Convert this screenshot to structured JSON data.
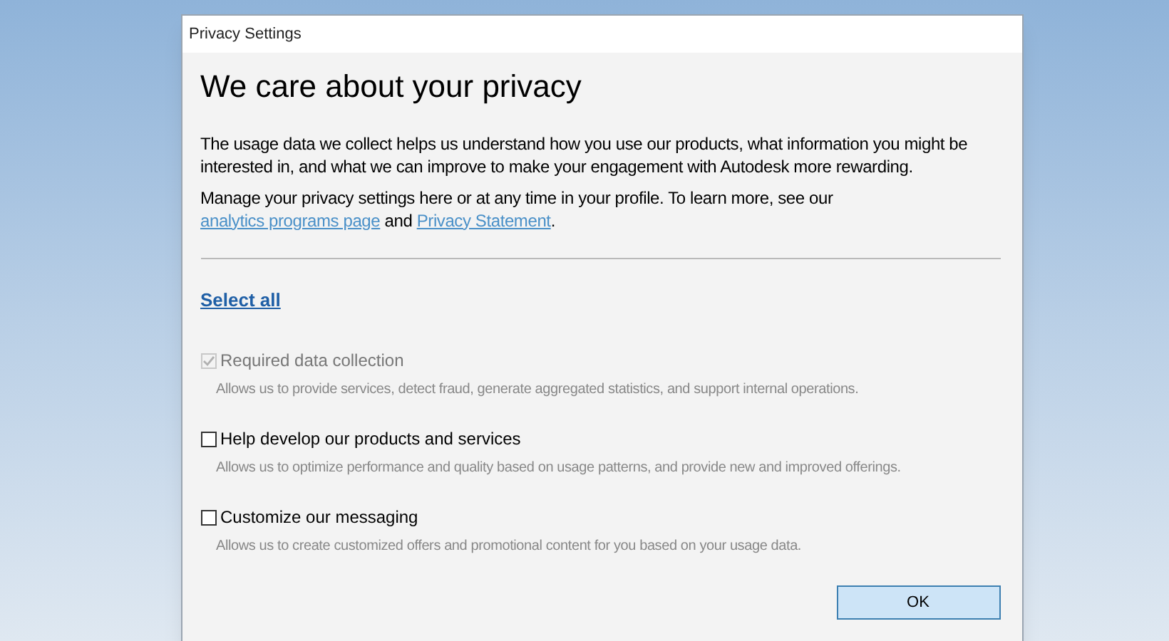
{
  "window": {
    "title": "Privacy Settings"
  },
  "heading": "We care about your privacy",
  "intro": "The usage data we collect helps us understand how you use our products, what information you might be interested in, and what we can improve to make your engagement with Autodesk more rewarding.",
  "manage": {
    "text_before": "Manage your privacy settings here or at any time in your profile. To learn more, see our",
    "link_1": "analytics programs page",
    "text_between": "and",
    "link_2": "Privacy Statement",
    "text_after": "."
  },
  "select_all": "Select all",
  "options": [
    {
      "label": "Required data collection",
      "description": "Allows us to provide services, detect fraud, generate aggregated statistics, and support internal operations.",
      "checked": true,
      "disabled": true
    },
    {
      "label": "Help develop our products and services",
      "description": "Allows us to optimize performance and quality based on usage patterns, and provide new and improved offerings.",
      "checked": false,
      "disabled": false
    },
    {
      "label": "Customize our messaging",
      "description": "Allows us to create customized offers and promotional content for you based on your usage data.",
      "checked": false,
      "disabled": false
    }
  ],
  "ok_button": "OK"
}
